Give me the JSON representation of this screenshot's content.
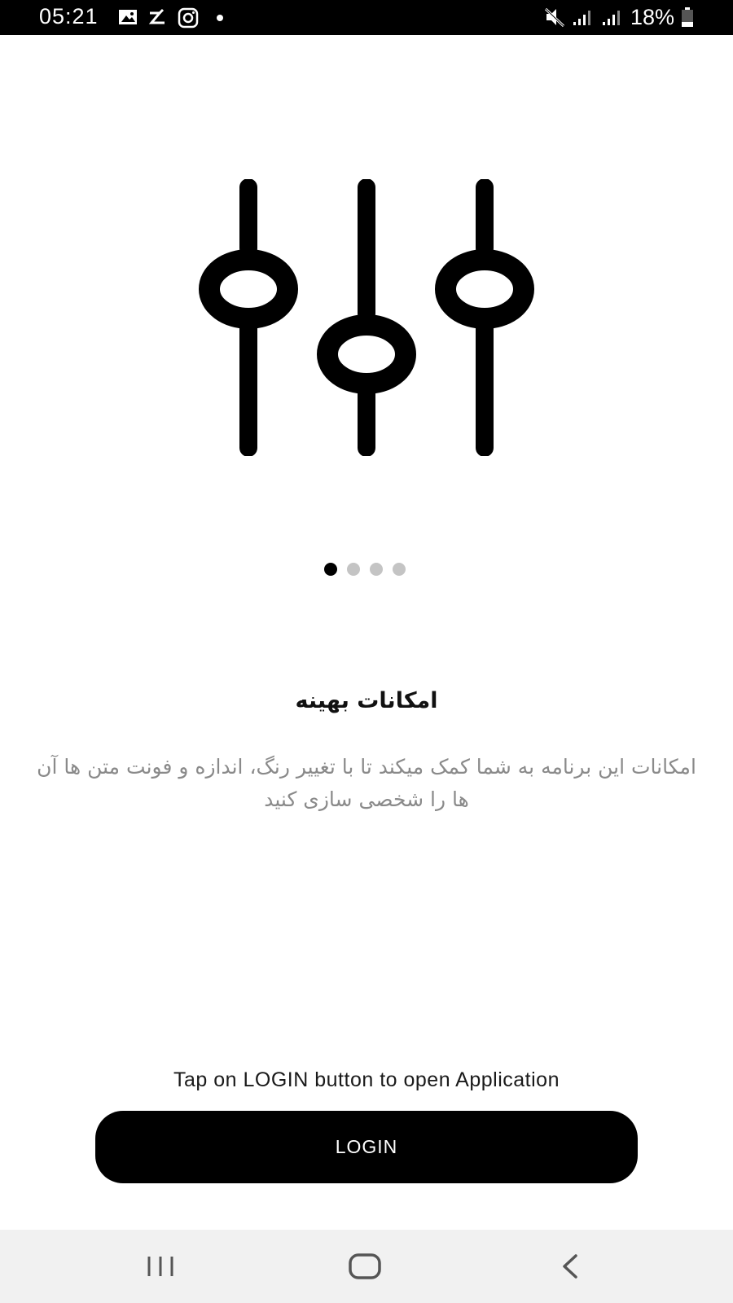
{
  "status_bar": {
    "time": "05:21",
    "battery": "18%",
    "icons": [
      "gallery-icon",
      "flash-icon",
      "instagram-icon",
      "dot-icon",
      "mute-icon",
      "signal-icon",
      "signal-icon",
      "battery-icon"
    ]
  },
  "illustration": {
    "icon": "sliders-icon"
  },
  "pager": {
    "count": 4,
    "active_index": 0
  },
  "content": {
    "title": "امکانات بهینه",
    "description": "امکانات این برنامه به شما کمک میکند تا با تغییر رنگ، اندازه و فونت متن ها آن ها را شخصی سازی کنید"
  },
  "hint": "Tap on LOGIN button to open Application",
  "login_button": {
    "label": "LOGIN"
  },
  "nav_bar": {
    "items": [
      "recents-icon",
      "home-icon",
      "back-icon"
    ]
  },
  "colors": {
    "primary": "#000000",
    "text_muted": "#8a8a8a",
    "dot_inactive": "#c4c4c4",
    "nav_background": "#f1f1f1"
  }
}
